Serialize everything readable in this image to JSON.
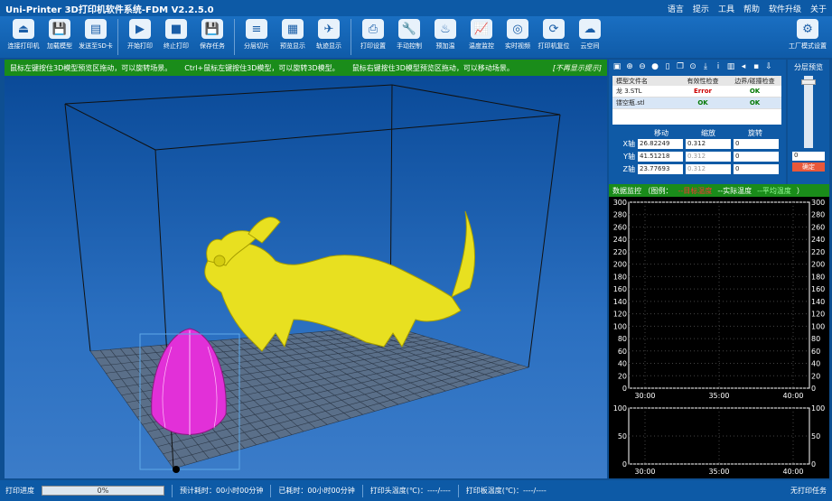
{
  "app": {
    "title": "Uni-Printer   3D打印机软件系统-FDM V2.2.5.0",
    "menu": [
      "语言",
      "提示",
      "工具",
      "帮助",
      "软件升级",
      "关于"
    ]
  },
  "toolbar": {
    "buttons": [
      {
        "label": "连接打印机",
        "icon": "plug-icon",
        "glyph": "⏏"
      },
      {
        "label": "加载模型",
        "icon": "save-icon",
        "glyph": "💾"
      },
      {
        "label": "发送至SD卡",
        "icon": "sd-card-icon",
        "glyph": "▤"
      },
      {
        "label": "开始打印",
        "icon": "play-icon",
        "glyph": "▶"
      },
      {
        "label": "终止打印",
        "icon": "stop-icon",
        "glyph": "■"
      },
      {
        "label": "保存任务",
        "icon": "save-task-icon",
        "glyph": "💾"
      },
      {
        "label": "分层切片",
        "icon": "layers-icon",
        "glyph": "≡"
      },
      {
        "label": "预览显示",
        "icon": "preview-icon",
        "glyph": "▦"
      },
      {
        "label": "轨迹显示",
        "icon": "path-icon",
        "glyph": "✈"
      },
      {
        "label": "打印设置",
        "icon": "printer-icon",
        "glyph": "⎙"
      },
      {
        "label": "手动控制",
        "icon": "wrench-icon",
        "glyph": "🔧"
      },
      {
        "label": "预加温",
        "icon": "heat-icon",
        "glyph": "♨"
      },
      {
        "label": "温度监控",
        "icon": "chart-icon",
        "glyph": "📈"
      },
      {
        "label": "实时视频",
        "icon": "camera-icon",
        "glyph": "◎"
      },
      {
        "label": "打印机复位",
        "icon": "reset-icon",
        "glyph": "⟳"
      },
      {
        "label": "云空间",
        "icon": "cloud-icon",
        "glyph": "☁"
      }
    ],
    "factory": {
      "label": "工厂模式设置",
      "glyph": "⚙"
    }
  },
  "hint": {
    "left": "鼠标左键按住3D模型预览区拖动，可以旋转场景。",
    "mid": "Ctrl+鼠标左键按住3D模型，可以旋转3D模型。",
    "right": "鼠标右键按住3D模型预览区拖动，可以移动场景。",
    "hide": "[不再显示提示]"
  },
  "files": {
    "headers": [
      "模型文件名",
      "有效性检查",
      "边界/碰撞检查"
    ],
    "rows": [
      {
        "name": "龙 3.STL",
        "valid": "Error",
        "bound": "OK"
      },
      {
        "name": "镂空瓶.stl",
        "valid": "OK",
        "bound": "OK"
      }
    ]
  },
  "transform": {
    "headers": [
      "移动",
      "缩放",
      "旋转"
    ],
    "rows": [
      {
        "axis": "X轴",
        "move": "26.82249",
        "scale": "0.312",
        "rot": "0"
      },
      {
        "axis": "Y轴",
        "move": "41.51218",
        "scale": "0.312",
        "rot": "0"
      },
      {
        "axis": "Z轴",
        "move": "23.77693",
        "scale": "0.312",
        "rot": "0"
      }
    ]
  },
  "slice": {
    "title": "分层预览",
    "value": "0",
    "button": "确定"
  },
  "monitor": {
    "title": "数据监控 （图例：",
    "legend1": "--目标温度",
    "legend2": "--实际温度",
    "legend3": "--平均温度",
    "end": "）"
  },
  "chart_data": [
    {
      "type": "line",
      "ylim": [
        0,
        300
      ],
      "yticks": [
        "300",
        "280",
        "260",
        "240",
        "220",
        "200",
        "180",
        "160",
        "140",
        "120",
        "100",
        "80",
        "60",
        "40",
        "20",
        "0"
      ],
      "xticks": [
        "30:00",
        "35:00",
        "40:00"
      ],
      "series": []
    },
    {
      "type": "line",
      "ylim": [
        0,
        100
      ],
      "yticks": [
        "100",
        "50",
        "0"
      ],
      "xticks": [
        "30:00",
        "35:00",
        "40:00"
      ],
      "series": []
    }
  ],
  "status": {
    "progress_label": "打印进度",
    "progress": "0%",
    "est": "预计耗时：00小时00分钟",
    "used": "已耗时：00小时00分钟",
    "head": "打印头温度(℃)：----/----",
    "bed": "打印板温度(℃)：----/----",
    "task": "无打印任务"
  }
}
